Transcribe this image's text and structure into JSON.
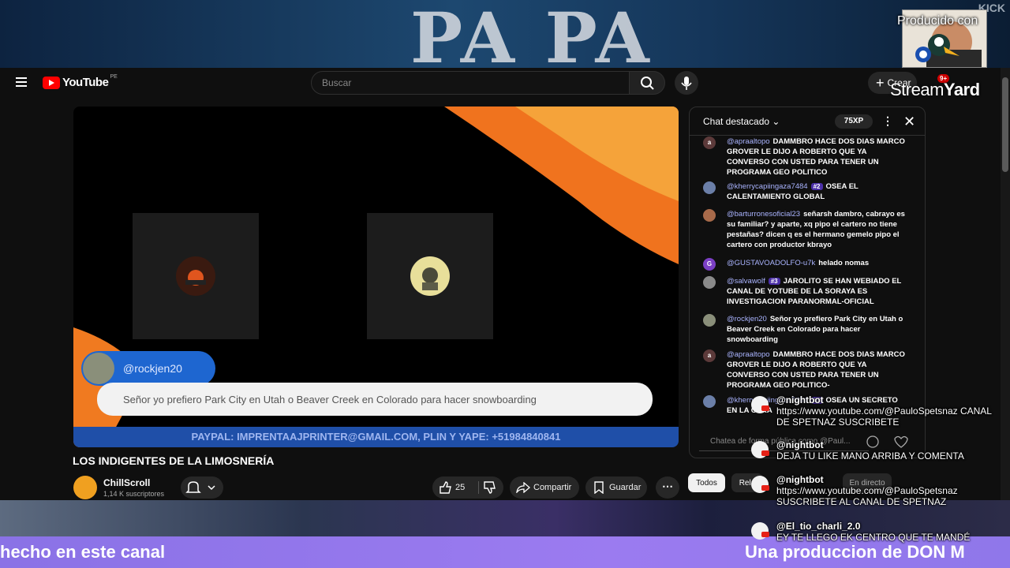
{
  "overlay": {
    "banner_word": "PA PA",
    "kick_label": "KICK",
    "producido": "Producido con",
    "streamyard_a": "Stream",
    "streamyard_b": "Yard",
    "lower_left": "hecho en este canal",
    "lower_right": "Una produccion de DON M"
  },
  "header": {
    "logo_text": "YouTube",
    "country": "PE",
    "search_placeholder": "Buscar",
    "create_label": "Crear",
    "notif_count": "9+"
  },
  "player": {
    "name_tag": "@rockjen20",
    "message": "Señor yo prefiero Park City en Utah o Beaver Creek en Colorado para hacer snowboarding",
    "paypal": "PAYPAL: IMPRENTAAJPRINTER@GMAIL.COM, PLIN Y YAPE: +51984840841"
  },
  "video": {
    "title": "LOS INDIGENTES DE LA LIMOSNERÍA",
    "channel": "ChillScroll",
    "subs": "1,14 K suscriptores",
    "likes": "25",
    "share": "Compartir",
    "save": "Guardar"
  },
  "chips": {
    "all": "Todos",
    "related": "Rela",
    "live": "En directo"
  },
  "chat": {
    "title": "Chat destacado",
    "xp": "75XP",
    "input_placeholder": "Chatea de forma pública como @Paul...",
    "messages": [
      {
        "initial": "a",
        "color": "#5c3a3a",
        "author": "@apraaltopo",
        "rank": "",
        "text": "DAMMBRO HACE DOS DIAS MARCO GROVER LE DIJO A ROBERTO QUE YA CONVERSO CON USTED PARA TENER UN PROGRAMA GEO POLITICO"
      },
      {
        "initial": "",
        "color": "#6b7fa8",
        "author": "@kherrycapiingaza7484",
        "rank": "#2",
        "text": "OSEA EL CALENTAMIENTO GLOBAL"
      },
      {
        "initial": "",
        "color": "#a86a4a",
        "author": "@barturronesoficial23",
        "rank": "",
        "text": "señarsh dambro, cabrayo es su familiar? y aparte, xq pipo el cartero no tiene pestañas? dicen q es el hermano gemelo pipo el cartero con productor kbrayo"
      },
      {
        "initial": "G",
        "color": "#7b3fc4",
        "author": "@GUSTAVOADOLFO-u7k",
        "rank": "",
        "text": "helado nomas"
      },
      {
        "initial": "",
        "color": "#8a8a8a",
        "author": "@salvawolf",
        "rank": "#3",
        "text": "JAROLITO SE HAN WEBIADO EL CANAL DE YOTUBE DE LA SORAYA ES INVESTIGACION PARANORMAL-OFICIAL"
      },
      {
        "initial": "",
        "color": "#8a8f7a",
        "author": "@rockjen20",
        "rank": "",
        "text": "Señor yo prefiero Park City en Utah o Beaver Creek en Colorado para hacer snowboarding"
      },
      {
        "initial": "a",
        "color": "#5c3a3a",
        "author": "@apraaltopo",
        "rank": "",
        "text": "DAMMBRO HACE DOS DIAS MARCO GROVER LE DIJO A ROBERTO QUE YA CONVERSO CON USTED PARA TENER UN PROGRAMA GEO POLITICO-"
      },
      {
        "initial": "",
        "color": "#6b7fa8",
        "author": "@kherrycapiingaza7484",
        "rank": "#2",
        "text": "OSEA UN SECRETO EN LA OTRA"
      }
    ]
  },
  "overlay_chat": [
    {
      "name": "@nightbot",
      "text": "https://www.youtube.com/@PauloSpetsnaz CANAL DE SPETNAZ SUSCRIBETE"
    },
    {
      "name": "@nightbot",
      "text": "DEJA TU LIKE MANO ARRIBA Y COMENTA"
    },
    {
      "name": "@nightbot",
      "text": "https://www.youtube.com/@PauloSpetsnaz SUSCRIBETE AL CANAL DE SPETNAZ"
    },
    {
      "name": "@El_tio_charli_2.0",
      "text": "EY TE LLEGO EK CENTRO QUE TE MANDÉ"
    }
  ]
}
